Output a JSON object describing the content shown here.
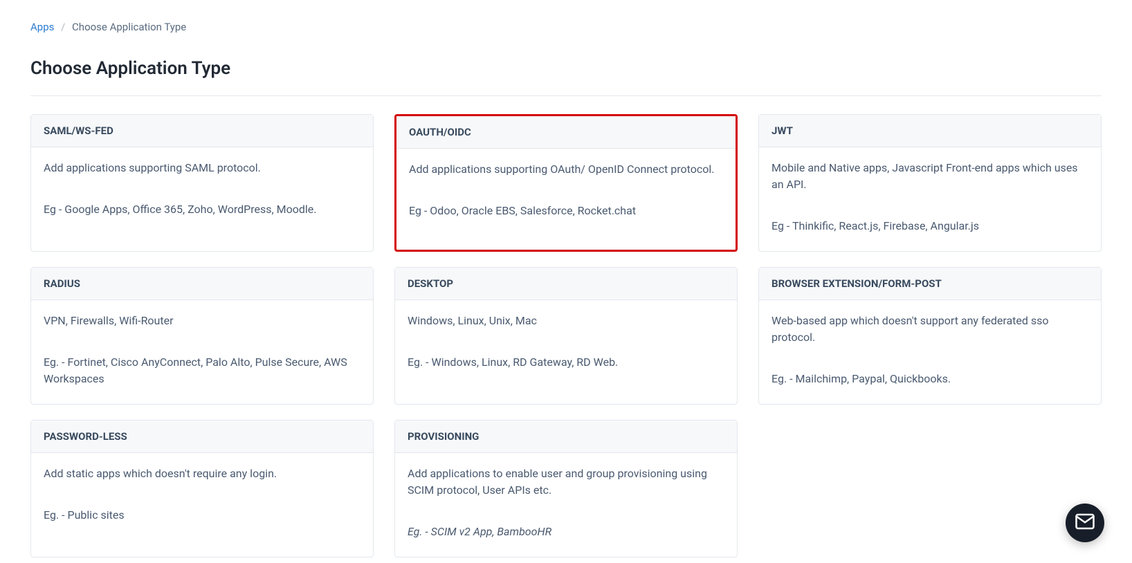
{
  "breadcrumb": {
    "parent": "Apps",
    "separator": "/",
    "current": "Choose Application Type"
  },
  "page_title": "Choose Application Type",
  "cards": [
    {
      "title": "SAML/WS-FED",
      "description": "Add applications supporting SAML protocol.",
      "example": "Eg - Google Apps, Office 365, Zoho, WordPress, Moodle.",
      "highlighted": false,
      "example_italic": false
    },
    {
      "title": "OAUTH/OIDC",
      "description": "Add applications supporting OAuth/ OpenID Connect protocol.",
      "example": "Eg - Odoo, Oracle EBS, Salesforce, Rocket.chat",
      "highlighted": true,
      "example_italic": false
    },
    {
      "title": "JWT",
      "description": "Mobile and Native apps, Javascript Front-end apps which uses an API.",
      "example": "Eg - Thinkific, React.js, Firebase, Angular.js",
      "highlighted": false,
      "example_italic": false
    },
    {
      "title": "RADIUS",
      "description": "VPN, Firewalls, Wifi-Router",
      "example": "Eg. - Fortinet, Cisco AnyConnect, Palo Alto, Pulse Secure, AWS Workspaces",
      "highlighted": false,
      "example_italic": false
    },
    {
      "title": "DESKTOP",
      "description": "Windows, Linux, Unix, Mac",
      "example": "Eg. - Windows, Linux, RD Gateway, RD Web.",
      "highlighted": false,
      "example_italic": false
    },
    {
      "title": "BROWSER EXTENSION/FORM-POST",
      "description": "Web-based app which doesn't support any federated sso protocol.",
      "example": "Eg. - Mailchimp, Paypal, Quickbooks.",
      "highlighted": false,
      "example_italic": false
    },
    {
      "title": "PASSWORD-LESS",
      "description": "Add static apps which doesn't require any login.",
      "example": "Eg. - Public sites",
      "highlighted": false,
      "example_italic": false
    },
    {
      "title": "PROVISIONING",
      "description": "Add applications to enable user and group provisioning using SCIM protocol, User APIs etc.",
      "example": "Eg. - SCIM v2 App, BambooHR",
      "highlighted": false,
      "example_italic": true
    }
  ],
  "help_fab": {
    "icon": "mail-icon"
  }
}
